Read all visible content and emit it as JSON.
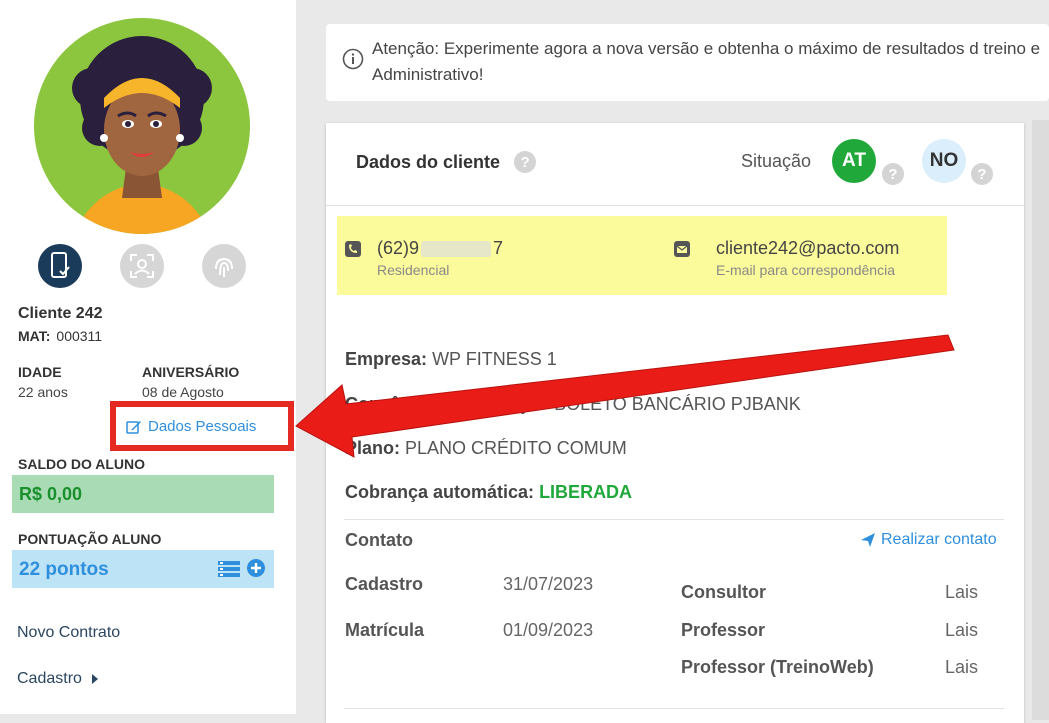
{
  "colors": {
    "accent_blue": "#2f8fdc",
    "highlight_red": "#e52a22",
    "status_green": "#20a83a",
    "saldo_bg": "#a9dcb4",
    "pontos_bg": "#bde3f7",
    "contact_highlight": "#fbfb9c"
  },
  "sidebar": {
    "client_name": "Cliente 242",
    "mat_label": "MAT:",
    "mat_value": "000311",
    "idade_label": "IDADE",
    "idade_value": "22 anos",
    "aniversario_label": "ANIVERSÁRIO",
    "aniversario_value": "08 de Agosto",
    "dados_pessoais": "Dados Pessoais",
    "saldo_label": "SALDO DO ALUNO",
    "saldo_value": "R$ 0,00",
    "pontuacao_label": "PONTUAÇÃO ALUNO",
    "pontos_value": "22 pontos",
    "menu": [
      "Novo Contrato",
      "Cadastro"
    ],
    "icons": [
      "mobile-app-icon",
      "face-recognition-icon",
      "fingerprint-icon"
    ]
  },
  "notice": {
    "text": "Atenção: Experimente agora a nova versão e obtenha o máximo de resultados d treino e Administrativo!"
  },
  "card": {
    "title": "Dados do cliente",
    "situacao_label": "Situação",
    "badge_at": "AT",
    "badge_no": "NO",
    "phone_prefix": "(62)9",
    "phone_suffix": "7",
    "phone_type": "Residencial",
    "email": "cliente242@pacto.com",
    "email_type": "E-mail para correspondência",
    "empresa_label": "Empresa:",
    "empresa_value": "WP FITNESS 1",
    "convenio_label": "Convênio de cobrança:",
    "convenio_value": "BOLETO BANCÁRIO PJBANK",
    "plano_label": "Plano:",
    "plano_value": "PLANO CRÉDITO COMUM",
    "cobranca_label": "Cobrança automática:",
    "cobranca_value": "LIBERADA",
    "contato_label": "Contato",
    "realizar_contato": "Realizar contato",
    "cadastro_label": "Cadastro",
    "cadastro_value": "31/07/2023",
    "matricula_label": "Matrícula",
    "matricula_value": "01/09/2023",
    "consultor_label": "Consultor",
    "consultor_value": "Lais",
    "professor_label": "Professor",
    "professor_value": "Lais",
    "professor_tw_label": "Professor (TreinoWeb)",
    "professor_tw_value": "Lais"
  }
}
